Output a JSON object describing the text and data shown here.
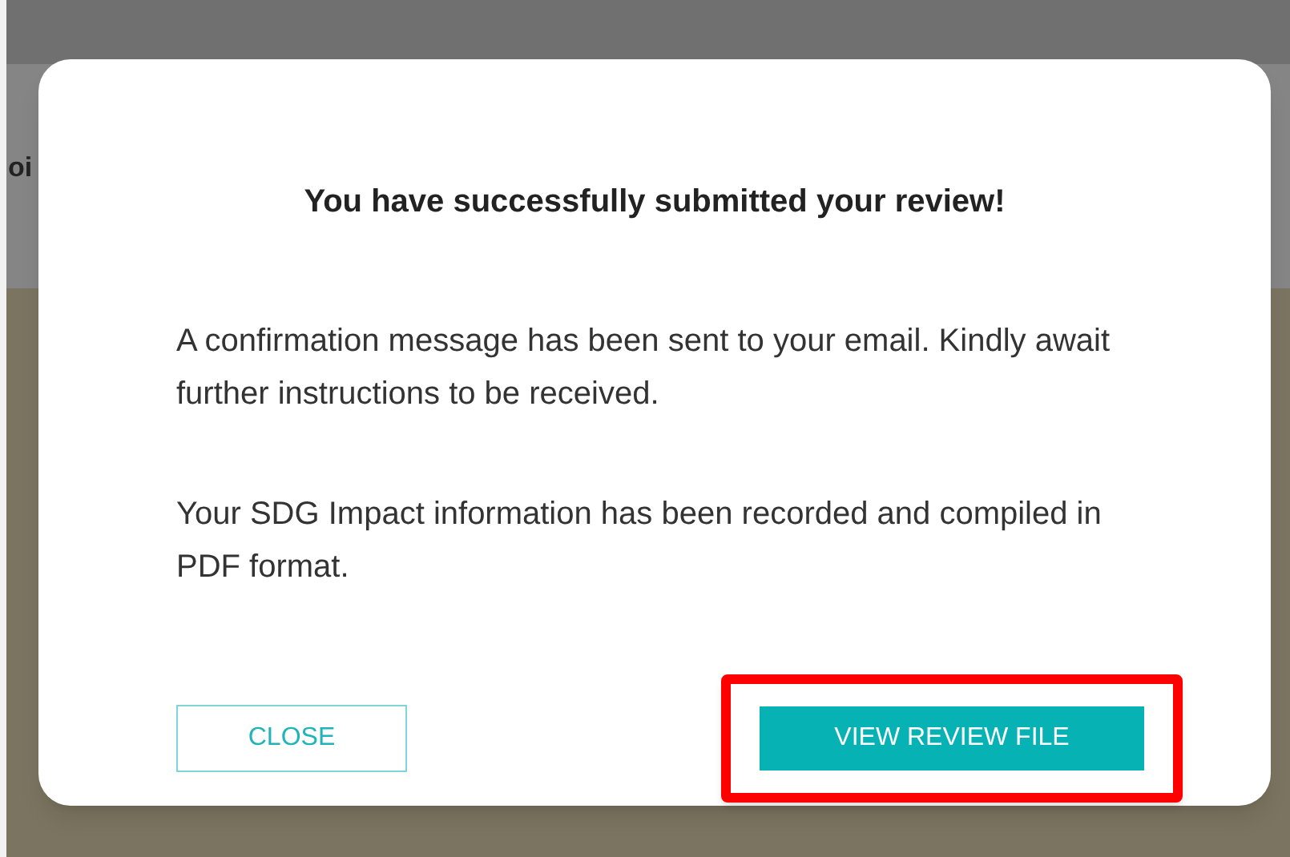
{
  "background": {
    "heading_fragment": "oi"
  },
  "dialog": {
    "title": "You have successfully submitted your review!",
    "paragraphs": [
      "A confirmation message has been sent to your email. Kindly await further instructions to be received.",
      "Your SDG Impact information has been recorded and compiled in PDF format."
    ],
    "buttons": [
      {
        "label": "CLOSE",
        "kind": "outline",
        "highlighted": false
      },
      {
        "label": "VIEW REVIEW FILE",
        "kind": "solid",
        "highlighted": true
      }
    ]
  }
}
